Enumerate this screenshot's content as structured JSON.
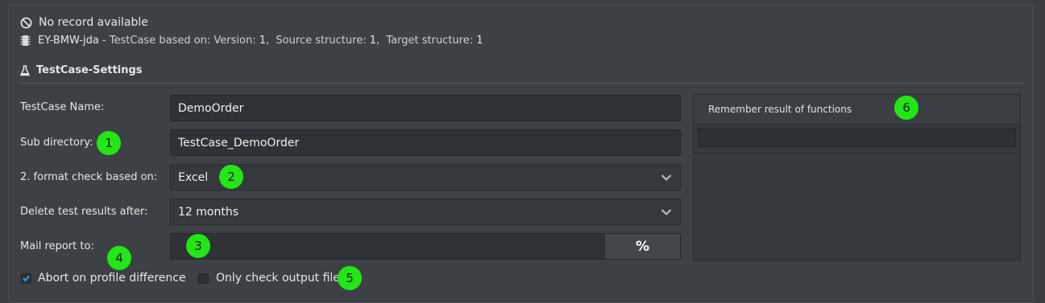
{
  "header": {
    "status_text": "No record available",
    "project_name": "EY-BMW-jda",
    "info_prefix": " - TestCase based on: Version: ",
    "version": "1",
    "source_label": ",  Source structure: ",
    "source_value": "1",
    "target_label": ",  Target structure: ",
    "target_value": "1"
  },
  "section": {
    "title": "TestCase-Settings"
  },
  "form": {
    "testcase_name": {
      "label": "TestCase Name:",
      "value": "DemoOrder"
    },
    "sub_directory": {
      "label": "Sub directory:",
      "value": "TestCase_DemoOrder"
    },
    "format_check": {
      "label": "2. format check based on:",
      "value": "Excel"
    },
    "delete_results": {
      "label": "Delete test results after:",
      "value": "12 months"
    },
    "mail_report": {
      "label": "Mail report to:",
      "value": "",
      "button_label": "%"
    }
  },
  "checkboxes": {
    "abort_on_profile": {
      "label": "Abort on profile difference",
      "checked": true
    },
    "only_check_output": {
      "label": "Only check output file",
      "checked": false
    }
  },
  "remember_panel": {
    "title": "Remember result of functions",
    "filter_value": ""
  },
  "markers": [
    "1",
    "2",
    "3",
    "4",
    "5",
    "6"
  ],
  "colors": {
    "accent": "#2aa4e6",
    "marker": "#22e616",
    "background": "#3d4145"
  }
}
